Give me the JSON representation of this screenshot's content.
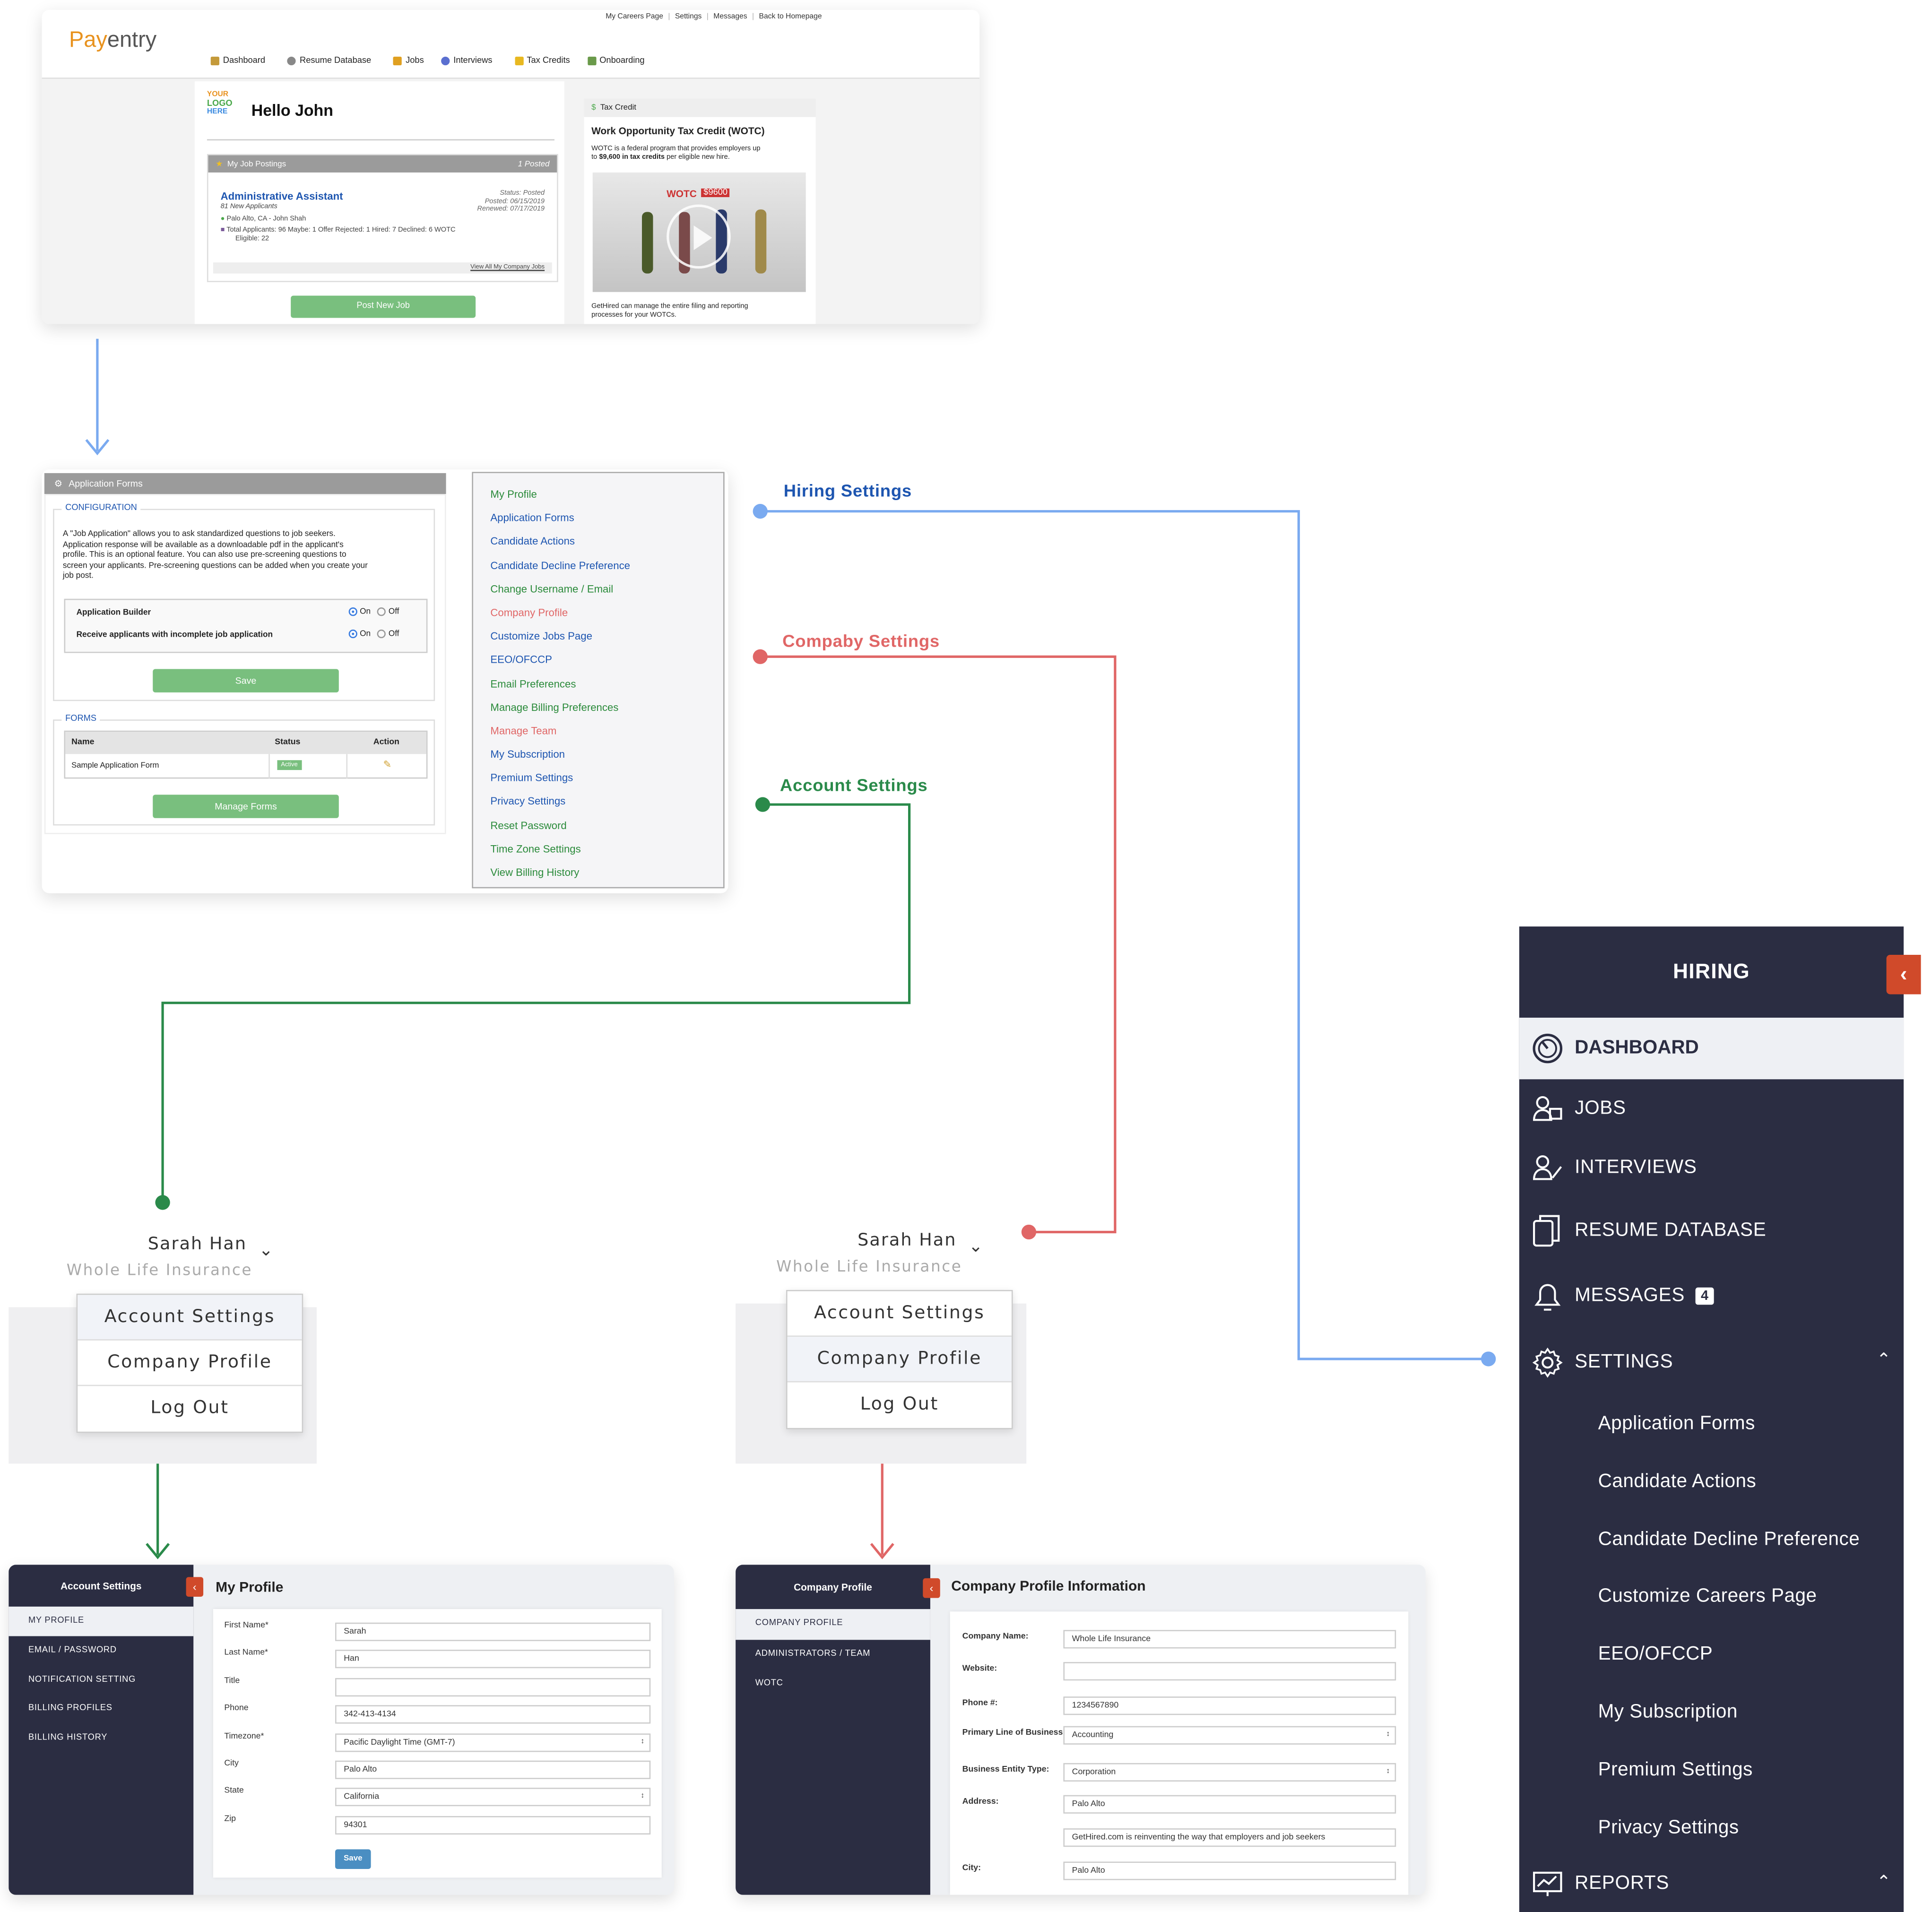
{
  "dashboard": {
    "logo_pay": "Pay",
    "logo_entry": "entry",
    "top_links": [
      "My Careers Page",
      "Settings",
      "Messages",
      "Back to Homepage"
    ],
    "nav": [
      "Dashboard",
      "Resume Database",
      "Jobs",
      "Interviews",
      "Tax Credits",
      "Onboarding"
    ],
    "your_logo": [
      "YOUR",
      "LOGO",
      "HERE"
    ],
    "greeting": "Hello John",
    "postings_header": "My Job Postings",
    "postings_count": "1 Posted",
    "job": {
      "title": "Administrative Assistant",
      "new_applicants": "81 New Applicants",
      "status": "Status: Posted",
      "posted": "Posted: 06/15/2019",
      "renewed": "Renewed: 07/17/2019",
      "location": "Palo Alto, CA - John Shah",
      "stats_line1": "Total Applicants: 96   Maybe: 1   Offer Rejected: 1   Hired: 7   Declined: 6   WOTC",
      "stats_line2": "Eligible: 22"
    },
    "view_all": "View All My Company Jobs",
    "post_button": "Post New Job",
    "tax_header": "Tax Credit",
    "tax_title": "Work Opportunity Tax Credit (WOTC)",
    "tax_text1": "WOTC is a federal program that provides employers up",
    "tax_text2_pre": "to ",
    "tax_text2_bold": "$9,600 in tax credits",
    "tax_text2_post": " per eligible new hire.",
    "wotc_label": "WOTC",
    "wotc_amount": "$9600",
    "tax_footer1": "GetHired can manage the entire filing and reporting",
    "tax_footer2": "processes for your WOTCs."
  },
  "app_forms": {
    "header": "Application Forms",
    "config_legend": "CONFIGURATION",
    "description": [
      "A \"Job Application\" allows you to ask standardized questions to job seekers.",
      "Application response will be available as a downloadable pdf in the applicant's",
      "profile. This is an optional feature. You can also use pre-screening questions to",
      "screen your applicants. Pre-screening questions can be added when you create your",
      "job post."
    ],
    "settings": [
      {
        "label": "Application Builder",
        "on": "On",
        "off": "Off"
      },
      {
        "label": "Receive applicants with incomplete job application",
        "on": "On",
        "off": "Off"
      }
    ],
    "save_button": "Save",
    "forms_legend": "FORMS",
    "table_headers": [
      "Name",
      "Status",
      "Action"
    ],
    "table_row": {
      "name": "Sample Application Form",
      "status": "Active"
    },
    "manage_button": "Manage Forms"
  },
  "settings_menu": [
    {
      "label": "My Profile",
      "color": "#2a8a3a"
    },
    {
      "label": "Application Forms",
      "color": "#1d55b0"
    },
    {
      "label": "Candidate Actions",
      "color": "#1d55b0"
    },
    {
      "label": "Candidate Decline Preference",
      "color": "#1d55b0"
    },
    {
      "label": "Change Username / Email",
      "color": "#2a8a3a"
    },
    {
      "label": "Company Profile",
      "color": "#e06666"
    },
    {
      "label": "Customize Jobs Page",
      "color": "#1d55b0"
    },
    {
      "label": "EEO/OFCCP",
      "color": "#1d55b0"
    },
    {
      "label": "Email Preferences",
      "color": "#2a8a3a"
    },
    {
      "label": "Manage Billing Preferences",
      "color": "#2a8a3a"
    },
    {
      "label": "Manage Team",
      "color": "#e06666"
    },
    {
      "label": "My Subscription",
      "color": "#1d55b0"
    },
    {
      "label": "Premium Settings",
      "color": "#1d55b0"
    },
    {
      "label": "Privacy Settings",
      "color": "#1d55b0"
    },
    {
      "label": "Reset Password",
      "color": "#2a8a3a"
    },
    {
      "label": "Time Zone Settings",
      "color": "#2a8a3a"
    },
    {
      "label": "View Billing History",
      "color": "#2a8a3a"
    }
  ],
  "flow_labels": {
    "hiring": "Hiring Settings",
    "company": "Compaby Settings",
    "account": "Account Settings"
  },
  "colors": {
    "hiring": "#7aaaf0",
    "company": "#e06666",
    "account": "#2a8a4a"
  },
  "user_menu": {
    "name": "Sarah Han",
    "company": "Whole Life Insurance",
    "items": [
      "Account Settings",
      "Company Profile",
      "Log Out"
    ]
  },
  "hiring_sidebar": {
    "title": "HIRING",
    "items": [
      "DASHBOARD",
      "JOBS",
      "INTERVIEWS",
      "RESUME DATABASE",
      "MESSAGES",
      "SETTINGS"
    ],
    "messages_badge": "4",
    "settings_sub": [
      "Application Forms",
      "Candidate Actions",
      "Candidate Decline Preference",
      "Customize Careers Page",
      "EEO/OFCCP",
      "My Subscription",
      "Premium Settings",
      "Privacy Settings"
    ],
    "reports": "REPORTS"
  },
  "account_page": {
    "sidebar_title": "Account Settings",
    "sidebar_items": [
      "MY PROFILE",
      "EMAIL / PASSWORD",
      "NOTIFICATION SETTING",
      "BILLING PROFILES",
      "BILLING HISTORY"
    ],
    "title": "My Profile",
    "fields": [
      {
        "label": "First Name*",
        "value": "Sarah"
      },
      {
        "label": "Last Name*",
        "value": "Han"
      },
      {
        "label": "Title",
        "value": ""
      },
      {
        "label": "Phone",
        "value": "342-413-4134"
      },
      {
        "label": "Timezone*",
        "value": "Pacific Daylight Time (GMT-7)"
      },
      {
        "label": "City",
        "value": "Palo Alto"
      },
      {
        "label": "State",
        "value": "California"
      },
      {
        "label": "Zip",
        "value": "94301"
      }
    ],
    "save_button": "Save"
  },
  "company_page": {
    "sidebar_title": "Company Profile",
    "sidebar_items": [
      "COMPANY PROFILE",
      "ADMINISTRATORS / TEAM",
      "WOTC"
    ],
    "title": "Company Profile Information",
    "fields": [
      {
        "label": "Company Name:",
        "value": "Whole Life Insurance"
      },
      {
        "label": "Website:",
        "value": ""
      },
      {
        "label": "Phone #:",
        "value": "1234567890"
      },
      {
        "label": "Primary Line of Business:",
        "value": "Accounting"
      },
      {
        "label": "Business Entity Type:",
        "value": "Corporation"
      },
      {
        "label": "Address:",
        "value": "Palo Alto"
      },
      {
        "label": "",
        "value": "GetHired.com is reinventing the way that employers and job seekers"
      },
      {
        "label": "City:",
        "value": "Palo Alto"
      }
    ]
  }
}
